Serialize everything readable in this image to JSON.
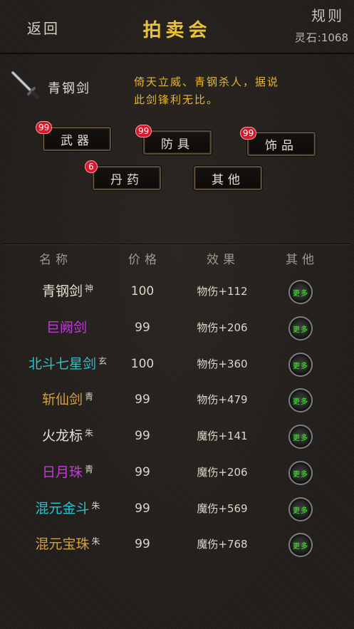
{
  "header": {
    "back_label": "返回",
    "title": "拍卖会",
    "rules_label": "规则",
    "currency_label": "灵石",
    "currency_value": ":1068"
  },
  "selected_item": {
    "name": "青钢剑",
    "desc_line1": "倚天立威、青钢杀人，据说",
    "desc_line2": "此剑锋利无比。",
    "icon": "sword-icon"
  },
  "categories": [
    {
      "label": "武器",
      "badge": "99"
    },
    {
      "label": "防具",
      "badge": "99"
    },
    {
      "label": "饰品",
      "badge": "99"
    },
    {
      "label": "丹药",
      "badge": "6"
    },
    {
      "label": "其他",
      "badge": ""
    }
  ],
  "table": {
    "headers": [
      "名称",
      "价格",
      "效果",
      "其他"
    ],
    "more_label": "更多",
    "rows": [
      {
        "name": "青钢剑",
        "tag": "神",
        "price": "100",
        "effect": "物伤+112",
        "color": "#e6e0d4"
      },
      {
        "name": "巨阙剑",
        "tag": "",
        "price": "99",
        "effect": "物伤+206",
        "color": "#c23bd6"
      },
      {
        "name": "北斗七星剑",
        "tag": "玄",
        "price": "100",
        "effect": "物伤+360",
        "color": "#2fc1c9"
      },
      {
        "name": "斩仙剑",
        "tag": "青",
        "price": "99",
        "effect": "物伤+479",
        "color": "#d3a23c"
      },
      {
        "name": "火龙标",
        "tag": "朱",
        "price": "99",
        "effect": "魔伤+141",
        "color": "#e6e0d4"
      },
      {
        "name": "日月珠",
        "tag": "青",
        "price": "99",
        "effect": "魔伤+206",
        "color": "#c23bd6"
      },
      {
        "name": "混元金斗",
        "tag": "朱",
        "price": "99",
        "effect": "魔伤+569",
        "color": "#2fc1c9"
      },
      {
        "name": "混元宝珠",
        "tag": "朱",
        "price": "99",
        "effect": "魔伤+768",
        "color": "#d3a23c"
      }
    ]
  }
}
